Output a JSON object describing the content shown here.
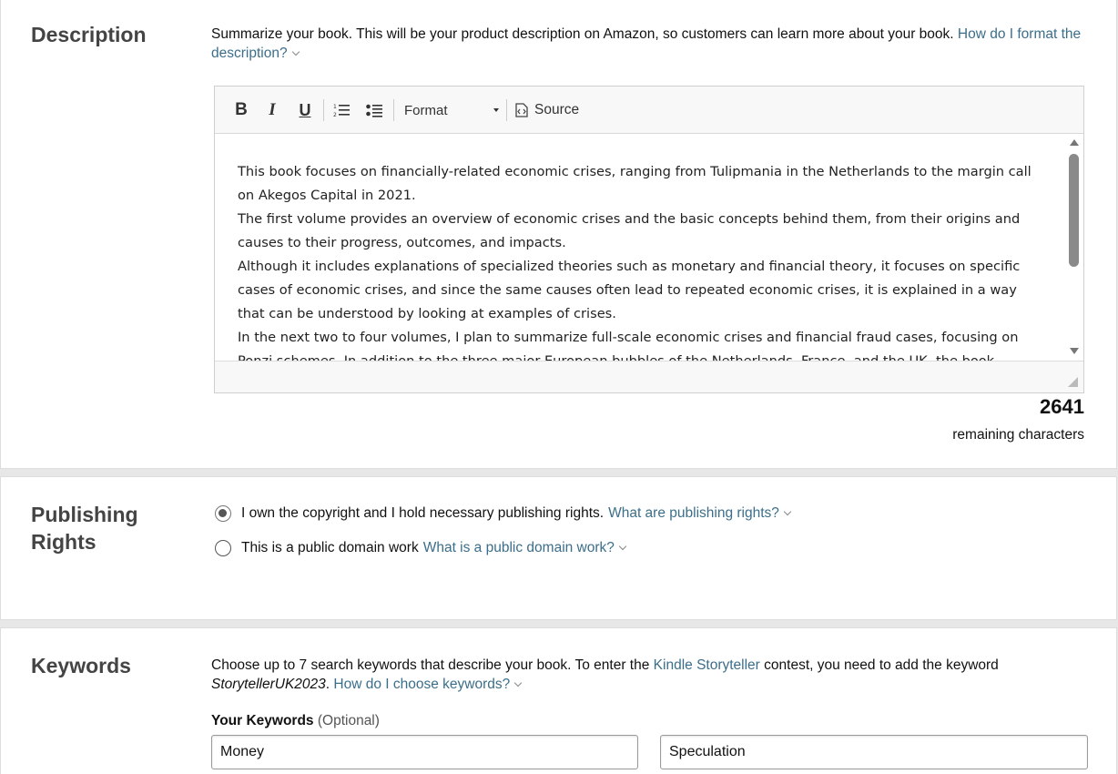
{
  "description": {
    "title": "Description",
    "intro_text": "Summarize your book. This will be your product description on Amazon, so customers can learn more about your book.",
    "help_link": "How do I format the description?",
    "toolbar": {
      "bold": "B",
      "italic": "I",
      "underline": "U",
      "format_label": "Format",
      "source_label": "Source"
    },
    "paragraphs": [
      "This book focuses on financially-related economic crises, ranging from Tulipmania in the Netherlands to the margin call on Akegos Capital in 2021.",
      "The first volume provides an overview of economic crises and the basic concepts behind them, from their origins and causes to their progress, outcomes, and impacts.",
      "Although it includes explanations of specialized theories such as monetary and financial theory, it focuses on specific cases of economic crises, and since the same causes often lead to repeated economic crises, it is explained in a way that can be understood by looking at examples of crises.",
      "In the next two to four volumes, I plan to summarize full-scale economic crises and financial fraud cases, focusing on Ponzi schemes. In addition to the three major European bubbles of the Netherlands, France, and the UK, the book"
    ],
    "remaining_count": "2641",
    "remaining_label": "remaining characters"
  },
  "publishing_rights": {
    "title_line1": "Publishing",
    "title_line2": "Rights",
    "options": [
      {
        "label": "I own the copyright and I hold necessary publishing rights.",
        "link": "What are publishing rights?",
        "selected": true
      },
      {
        "label": "This is a public domain work",
        "link": "What is a public domain work?",
        "selected": false
      }
    ]
  },
  "keywords": {
    "title": "Keywords",
    "intro_part1": "Choose up to 7 search keywords that describe your book. To enter the",
    "intro_link": "Kindle Storyteller",
    "intro_part2": "contest, you need to add the keyword",
    "intro_keyword": "StorytellerUK2023",
    "intro_period": ".",
    "help_link": "How do I choose keywords?",
    "field_label": "Your Keywords",
    "field_optional": "(Optional)",
    "values": [
      "Money",
      "Speculation"
    ]
  },
  "colors": {
    "link": "#3b6e8a",
    "heading": "#444444",
    "section_bg": "#ffffff",
    "page_bg": "#e7e7e7"
  }
}
